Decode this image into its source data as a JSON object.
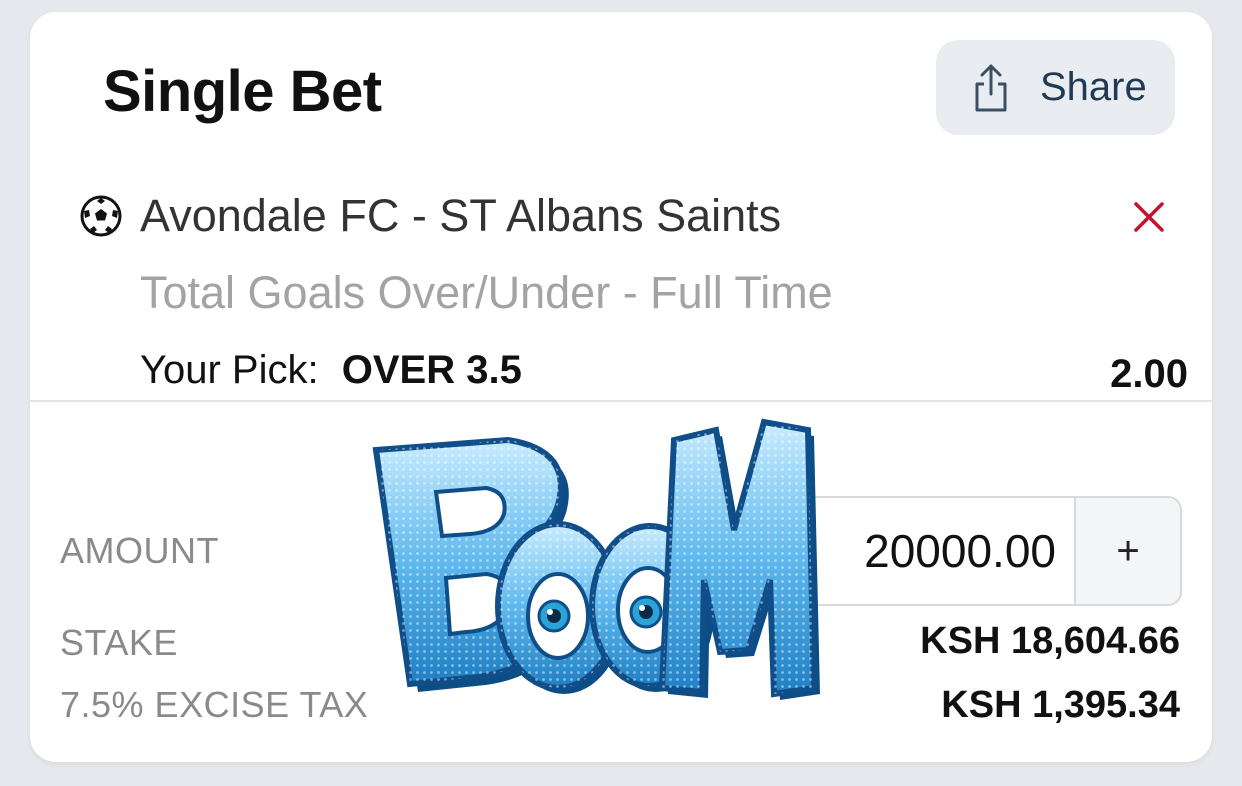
{
  "header": {
    "title": "Single Bet",
    "share_label": "Share"
  },
  "bet": {
    "event": "Avondale FC - ST Albans Saints",
    "market": "Total Goals Over/Under - Full Time",
    "pick_label": "Your Pick:",
    "pick_value": "OVER 3.5",
    "odds": "2.00"
  },
  "stake_panel": {
    "amount_label": "AMOUNT",
    "amount_value": "20000.00",
    "plus_label": "+",
    "stake_label": "STAKE",
    "stake_value": "KSH 18,604.66",
    "tax_label": "7.5% EXCISE TAX",
    "tax_value": "KSH 1,395.34"
  },
  "sticker": {
    "text": "BOOM"
  },
  "icons": {
    "share": "share-icon",
    "ball": "soccer-ball-icon",
    "remove": "close-icon"
  },
  "colors": {
    "share_text": "#1f3a52",
    "remove_x": "#c8102e",
    "muted_text": "#a3a3a3",
    "sticker_blue": "#2f8fd0"
  }
}
